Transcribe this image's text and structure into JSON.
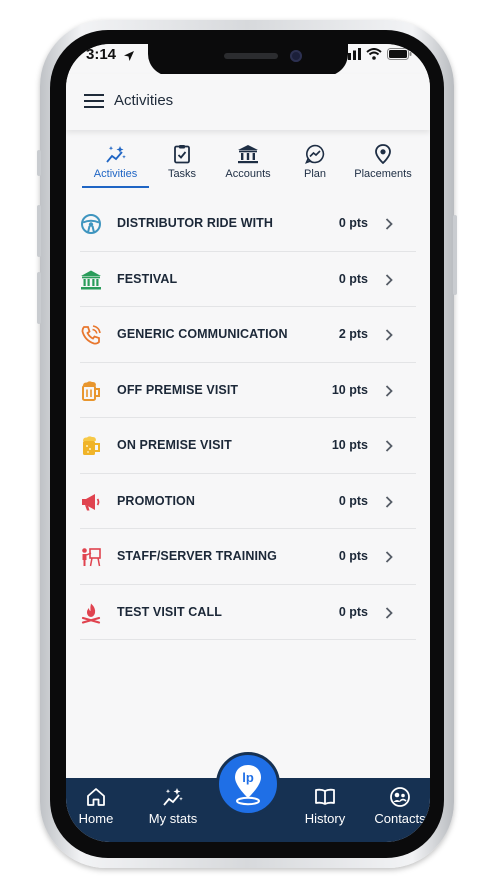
{
  "status_bar": {
    "time": "3:14"
  },
  "header": {
    "title": "Activities"
  },
  "tabs": [
    {
      "label": "Activities",
      "icon": "sparkles-icon",
      "active": true
    },
    {
      "label": "Tasks",
      "icon": "clipboard-check-icon",
      "active": false
    },
    {
      "label": "Accounts",
      "icon": "bank-icon",
      "active": false
    },
    {
      "label": "Plan",
      "icon": "trend-chat-icon",
      "active": false
    },
    {
      "label": "Placements",
      "icon": "location-pin-icon",
      "active": false
    }
  ],
  "activities": [
    {
      "label": "DISTRIBUTOR RIDE WITH",
      "points": "0 pts",
      "icon": "steering-wheel-icon",
      "color": "#3f95bf"
    },
    {
      "label": "FESTIVAL",
      "points": "0 pts",
      "icon": "institution-icon",
      "color": "#2a9c5a"
    },
    {
      "label": "GENERIC COMMUNICATION",
      "points": "2 pts",
      "icon": "phone-call-icon",
      "color": "#e8772e"
    },
    {
      "label": "OFF PREMISE VISIT",
      "points": "10 pts",
      "icon": "beer-mug-icon",
      "color": "#e8962e"
    },
    {
      "label": "ON PREMISE VISIT",
      "points": "10 pts",
      "icon": "beer-mug-filled-icon",
      "color": "#f0b429"
    },
    {
      "label": "PROMOTION",
      "points": "0 pts",
      "icon": "megaphone-icon",
      "color": "#e0434f"
    },
    {
      "label": "STAFF/SERVER TRAINING",
      "points": "0 pts",
      "icon": "presenter-icon",
      "color": "#e0434f"
    },
    {
      "label": "TEST VISIT CALL",
      "points": "0 pts",
      "icon": "campfire-icon",
      "color": "#e0434f"
    }
  ],
  "bottom_nav": [
    {
      "label": "Home",
      "icon": "home-icon"
    },
    {
      "label": "My stats",
      "icon": "stats-sparkle-icon"
    },
    {
      "label": "History",
      "icon": "open-book-icon"
    },
    {
      "label": "Contacts",
      "icon": "contacts-icon"
    }
  ],
  "fab": {
    "label": "lp",
    "icon": "lp-location-icon"
  },
  "colors": {
    "accent": "#1f65c4",
    "nav_bg": "#163152",
    "fab": "#1f6fe6"
  }
}
